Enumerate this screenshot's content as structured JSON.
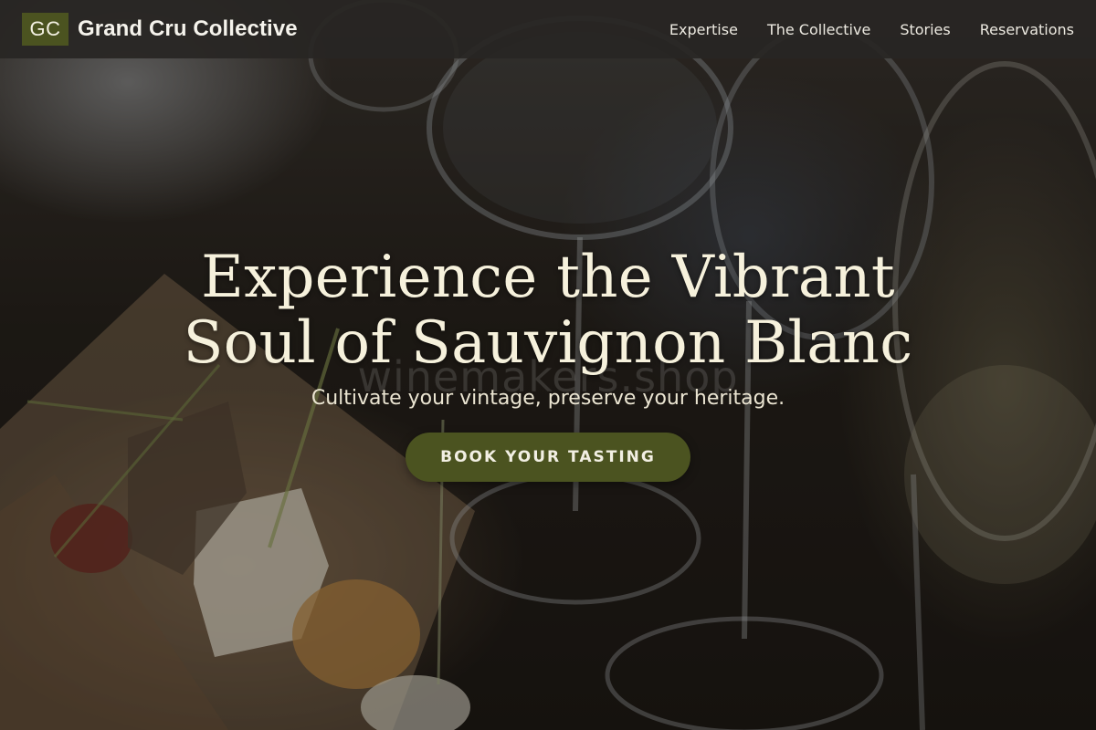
{
  "colors": {
    "brand": "#4b5320",
    "navbar_bg": "#282624",
    "hero_text": "#f6f1dc"
  },
  "navbar": {
    "logo_text": "GC",
    "brand_name": "Grand Cru Collective",
    "links": [
      {
        "label": "Expertise"
      },
      {
        "label": "The Collective"
      },
      {
        "label": "Stories"
      },
      {
        "label": "Reservations"
      }
    ]
  },
  "hero": {
    "title_line_1": "Experience the Vibrant",
    "title_line_2": "Soul of Sauvignon Blanc",
    "watermark": "winemakers.shop",
    "subtitle": "Cultivate your vintage, preserve your heritage.",
    "cta_label": "BOOK YOUR TASTING",
    "background_image": "wine-glasses-and-cheese-board-photo"
  }
}
